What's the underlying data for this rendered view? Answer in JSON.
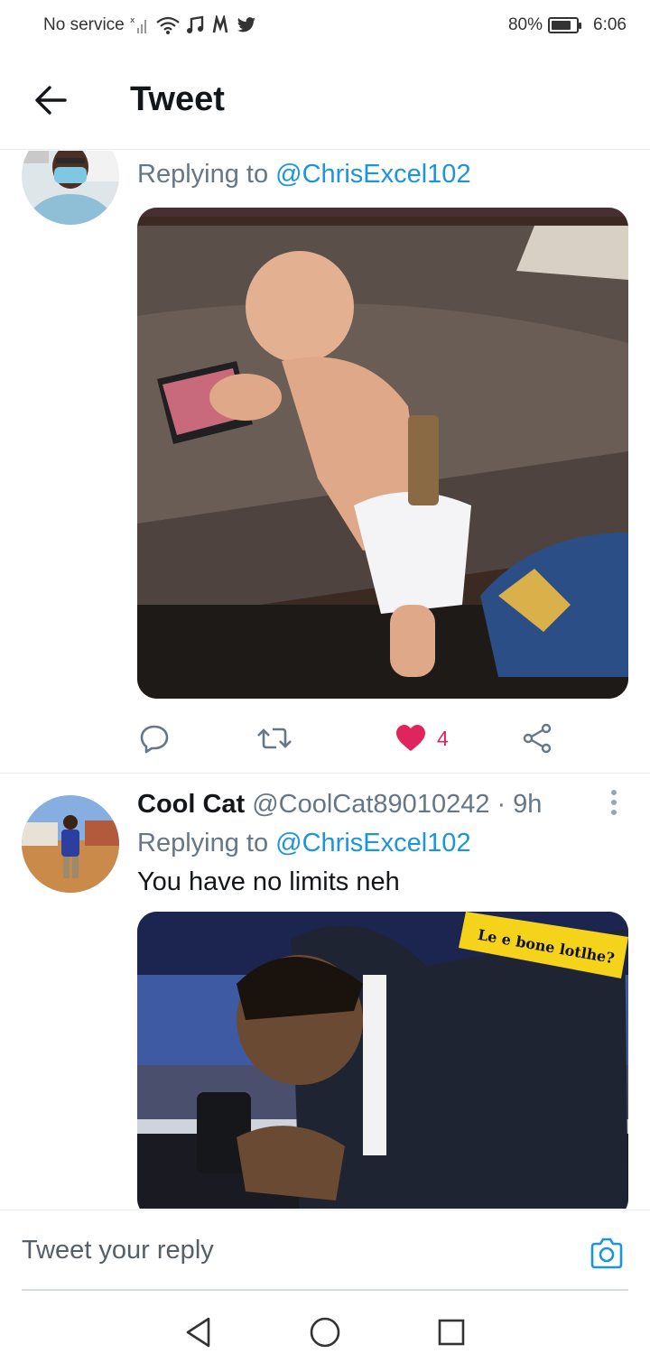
{
  "status_bar": {
    "carrier": "No service",
    "battery_percent": "80%",
    "battery_level": 0.8,
    "time": "6:06"
  },
  "header": {
    "title": "Tweet"
  },
  "tweet1": {
    "replying_prefix": "Replying to ",
    "replying_handle": "@ChrisExcel102",
    "like_count": "4"
  },
  "tweet2": {
    "display_name": "Cool Cat",
    "handle": "@CoolCat89010242",
    "separator": "·",
    "time": "9h",
    "replying_prefix": "Replying to ",
    "replying_handle": "@ChrisExcel102",
    "text": "You have no limits neh",
    "image_caption": "Le e bone lotlhe?"
  },
  "composer": {
    "placeholder": "Tweet your reply"
  },
  "colors": {
    "like": "#e0245e",
    "link": "#1b95e0",
    "secondary_text": "#657786"
  },
  "icons": [
    "wifi-icon",
    "music-icon",
    "notes-icon",
    "twitter-icon",
    "back-arrow-icon",
    "reply-icon",
    "retweet-icon",
    "heart-icon",
    "share-icon",
    "more-icon",
    "camera-icon",
    "nav-back-icon",
    "nav-home-icon",
    "nav-recents-icon"
  ]
}
